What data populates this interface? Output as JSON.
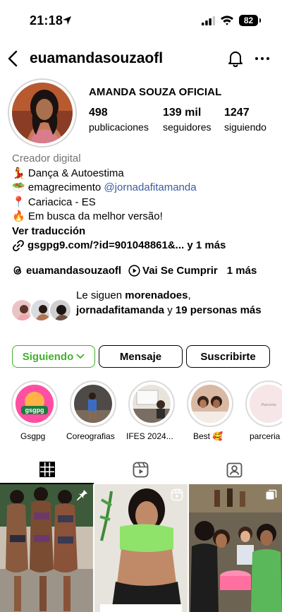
{
  "status_bar": {
    "time": "21:18",
    "battery": "82"
  },
  "header": {
    "username": "euamandasouzaofl"
  },
  "profile": {
    "display_name": "AMANDA SOUZA OFICIAL",
    "stats": [
      {
        "value": "498",
        "label": "publicaciones"
      },
      {
        "value": "139 mil",
        "label": "seguidores"
      },
      {
        "value": "1247",
        "label": "siguiendo"
      }
    ],
    "category": "Creador digital",
    "bio": {
      "line1_emoji": "💃",
      "line1": "Dança & Autoestima",
      "line2_emoji": "🥗",
      "line2_text": "emagrecimento ",
      "line2_mention": "@jornadafitamanda",
      "line3_emoji": "📍",
      "line3": "Cariacica - ES",
      "line4_emoji": "🔥",
      "line4": "Em busca da melhor versão!"
    },
    "translate_label": "Ver traducción",
    "link_text": "gsgpg9.com/?id=901048861&...",
    "link_more": " y 1 más",
    "threads": {
      "handle": "euamandasouzaofl",
      "reel": "Vai Se Cumprir",
      "more": "1 más"
    },
    "followed_by": {
      "prefix": "Le siguen ",
      "name1": "morenadoes",
      "sep": ",",
      "name2": "jornadafitamanda",
      "mid": " y ",
      "count": "19 personas más"
    }
  },
  "actions": {
    "following": "Siguiendo",
    "message": "Mensaje",
    "subscribe": "Suscribirte"
  },
  "highlights": [
    "Gsgpg",
    "Coreografias",
    "IFES 2024...",
    "Best 🥰",
    "parceria"
  ],
  "highlight_inner_text": {
    "gsgpg": "gsgpg",
    "parceria": "Parceria"
  },
  "tabs": [
    "grid-icon",
    "reels-icon",
    "tagged-icon"
  ],
  "colors": {
    "following_green": "#43b02a",
    "mention_blue": "#3a5ba0",
    "category_gray": "#737373"
  }
}
